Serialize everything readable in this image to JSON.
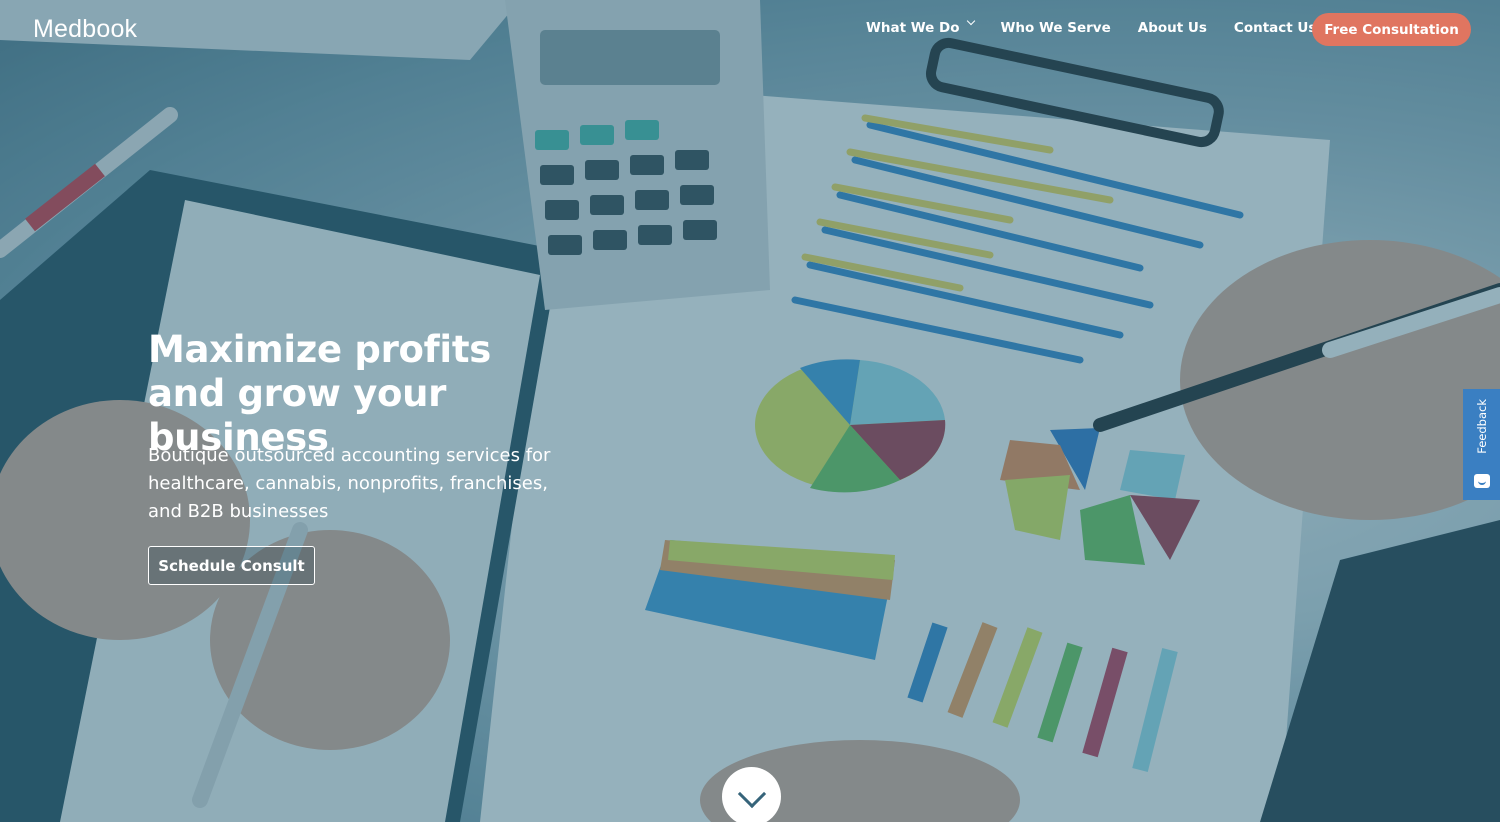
{
  "brand": {
    "logo_text": "Medbook"
  },
  "nav": {
    "items": [
      {
        "label": "What We Do",
        "has_dropdown": true
      },
      {
        "label": "Who We Serve",
        "has_dropdown": false
      },
      {
        "label": "About Us",
        "has_dropdown": false
      },
      {
        "label": "Contact Us",
        "has_dropdown": false
      }
    ],
    "cta_label": "Free Consultation"
  },
  "hero": {
    "headline": "Maximize profits and grow your business",
    "subtext": "Boutique outsourced accounting services for healthcare, cannabis, nonprofits, franchises, and B2B businesses",
    "button_label": "Schedule Consult"
  },
  "feedback_tab": {
    "label": "Feedback",
    "icon": "chat-smile-icon"
  },
  "scroll_indicator": {
    "icon": "chevron-down-icon"
  },
  "colors": {
    "cta_background": "#e07560",
    "overlay": "#30647a",
    "feedback_background": "#3a7fc2",
    "scroll_chevron": "#36647a"
  }
}
